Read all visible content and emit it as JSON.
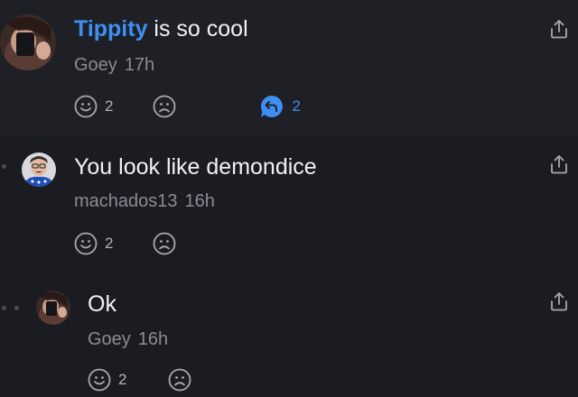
{
  "comments": [
    {
      "mention": "Tippity",
      "text": " is so cool",
      "author": "Goey",
      "time": "17h",
      "likes": "2",
      "replies": "2"
    },
    {
      "text": "You look like demondice",
      "author": "machados13",
      "time": "16h",
      "likes": "2"
    },
    {
      "text": "Ok",
      "author": "Goey",
      "time": "16h",
      "likes": "2"
    }
  ],
  "colors": {
    "accent": "#3d8ff5",
    "background": "#1b1c22",
    "highlight_row": "#1f2025",
    "muted": "#8b8c94"
  },
  "icons": [
    "smile-icon",
    "frown-icon",
    "reply-bubble-icon",
    "share-icon",
    "avatar"
  ]
}
